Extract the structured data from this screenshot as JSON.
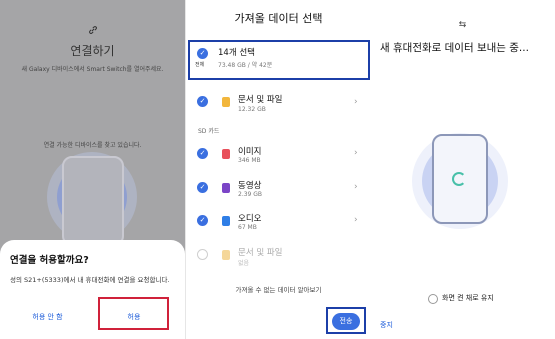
{
  "panel1": {
    "title": "연결하기",
    "subtitle": "새 Galaxy 디바이스에서 Smart Switch를 열어주세요.",
    "searching": "연결 가능한 디바이스를 찾고 있습니다.",
    "dialog": {
      "title": "연결을 허용할까요?",
      "message": "성의 S21+(5333)에서 내 휴대전화에 연결을 요청합니다.",
      "deny_label": "허용 안 함",
      "allow_label": "허용"
    }
  },
  "panel2": {
    "title": "가져올 데이터 선택",
    "select_all": {
      "check_label": "전체",
      "name": "14개 선택",
      "size": "73.48 GB / 약 42분"
    },
    "items": [
      {
        "name": "문서 및 파일",
        "size": "12.32 GB",
        "checked": true,
        "icon_color": "#f2b63c"
      }
    ],
    "section_sd": "SD 카드",
    "sd_items": [
      {
        "name": "이미지",
        "size": "346 MB",
        "checked": true,
        "icon_color": "#e8505b"
      },
      {
        "name": "동영상",
        "size": "2.39 GB",
        "checked": true,
        "icon_color": "#7b45c7"
      },
      {
        "name": "오디오",
        "size": "67 MB",
        "checked": true,
        "icon_color": "#2f7ee6"
      },
      {
        "name": "문서 및 파일",
        "size": "없음",
        "checked": false,
        "icon_color": "#f5d79a"
      }
    ],
    "unavailable_link": "가져올 수 없는 데이터 알아보기",
    "send_label": "전송"
  },
  "panel3": {
    "title": "새 휴대전화로 데이터 보내는 중...",
    "keep_screen_label": "화면 켠 채로 유지",
    "stop_label": "중지"
  }
}
